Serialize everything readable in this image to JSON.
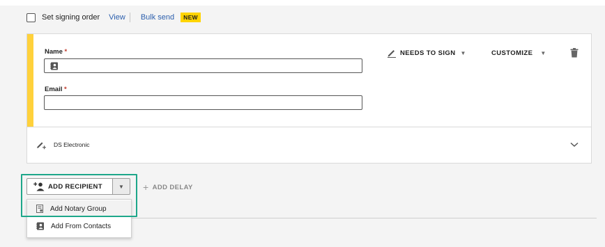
{
  "signing_order": {
    "checkbox_label": "Set signing order",
    "view_link": "View",
    "bulk_send_link": "Bulk send",
    "new_badge": "NEW"
  },
  "recipient": {
    "name_label": "Name",
    "email_label": "Email",
    "required_mark": "*",
    "name_value": "",
    "email_value": "",
    "action_label": "NEEDS TO SIGN",
    "customize_label": "CUSTOMIZE",
    "field_type_label": "DS Electronic",
    "accent_color": "#ffd13b"
  },
  "actions": {
    "add_recipient_label": "ADD RECIPIENT",
    "add_delay_label": "ADD DELAY"
  },
  "dropdown": {
    "items": [
      {
        "label": "Add Notary Group",
        "icon": "notary-group-icon"
      },
      {
        "label": "Add From Contacts",
        "icon": "contacts-icon"
      }
    ]
  },
  "colors": {
    "link": "#2c5fad",
    "badge": "#ffd400",
    "highlight_outline": "#1ea78a"
  }
}
